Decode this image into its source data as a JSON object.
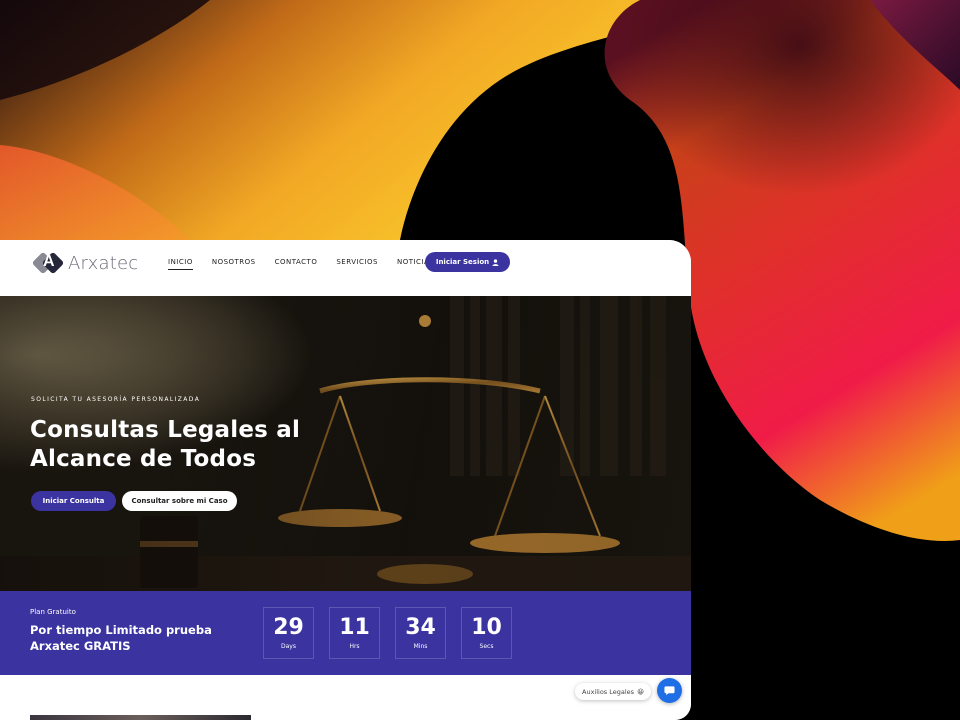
{
  "brand": {
    "name": "Arxatec",
    "accent_color": "#3a33a0"
  },
  "nav": {
    "items": [
      {
        "label": "INICIO",
        "active": true
      },
      {
        "label": "NOSOTROS",
        "active": false
      },
      {
        "label": "CONTACTO",
        "active": false
      },
      {
        "label": "SERVICIOS",
        "active": false
      },
      {
        "label": "NOTICIAS",
        "active": false
      }
    ],
    "login_label": "Iniciar Sesion",
    "login_icon": "user-icon"
  },
  "hero": {
    "eyebrow": "SOLICITA TU ASESORÍA PERSONALIZADA",
    "title": "Consultas Legales al Alcance de Todos",
    "primary_button": "Iniciar Consulta",
    "secondary_button": "Consultar sobre mi Caso"
  },
  "promo": {
    "small_label": "Plan Gratuito",
    "title": "Por tiempo Limitado prueba Arxatec GRATIS",
    "countdown": [
      {
        "value": "29",
        "label": "Days"
      },
      {
        "value": "11",
        "label": "Hrs"
      },
      {
        "value": "34",
        "label": "Mins"
      },
      {
        "value": "10",
        "label": "Secs"
      }
    ]
  },
  "chat": {
    "label": "Auxilios Legales",
    "emoji": "😀",
    "icon": "chat-bubble-icon"
  }
}
